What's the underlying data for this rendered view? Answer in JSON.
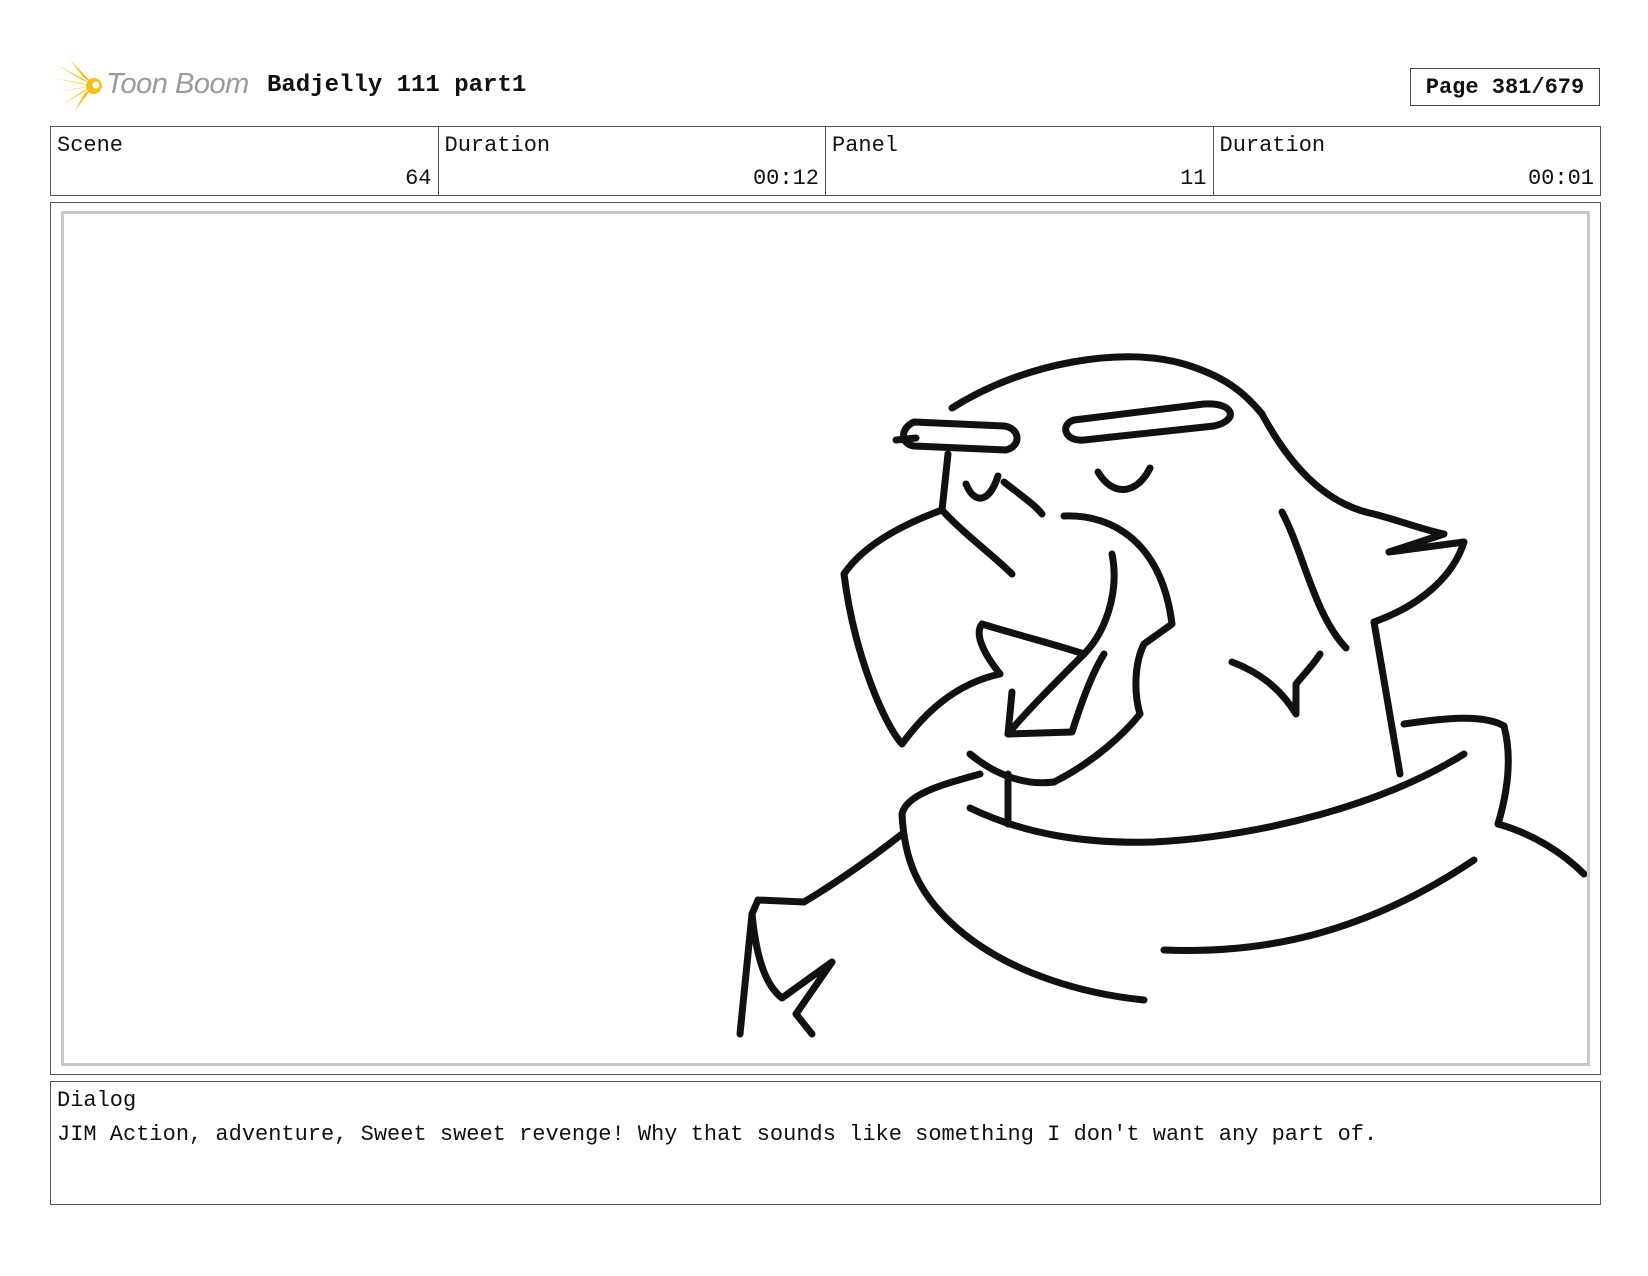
{
  "header": {
    "logo_text": "Toon Boom",
    "logo_icon": "toon-boom-starburst-icon",
    "title": "Badjelly 111 part1",
    "page": "Page 381/679"
  },
  "info": {
    "scene_label": "Scene",
    "scene_value": "64",
    "scene_duration_label": "Duration",
    "scene_duration_value": "00:12",
    "panel_label": "Panel",
    "panel_value": "11",
    "panel_duration_label": "Duration",
    "panel_duration_value": "00:01"
  },
  "panel": {
    "image": "storyboard-sketch-eagle-character"
  },
  "dialog": {
    "label": "Dialog",
    "text": "JIM Action, adventure, Sweet sweet revenge! Why that sounds like something I don't want any part of."
  }
}
